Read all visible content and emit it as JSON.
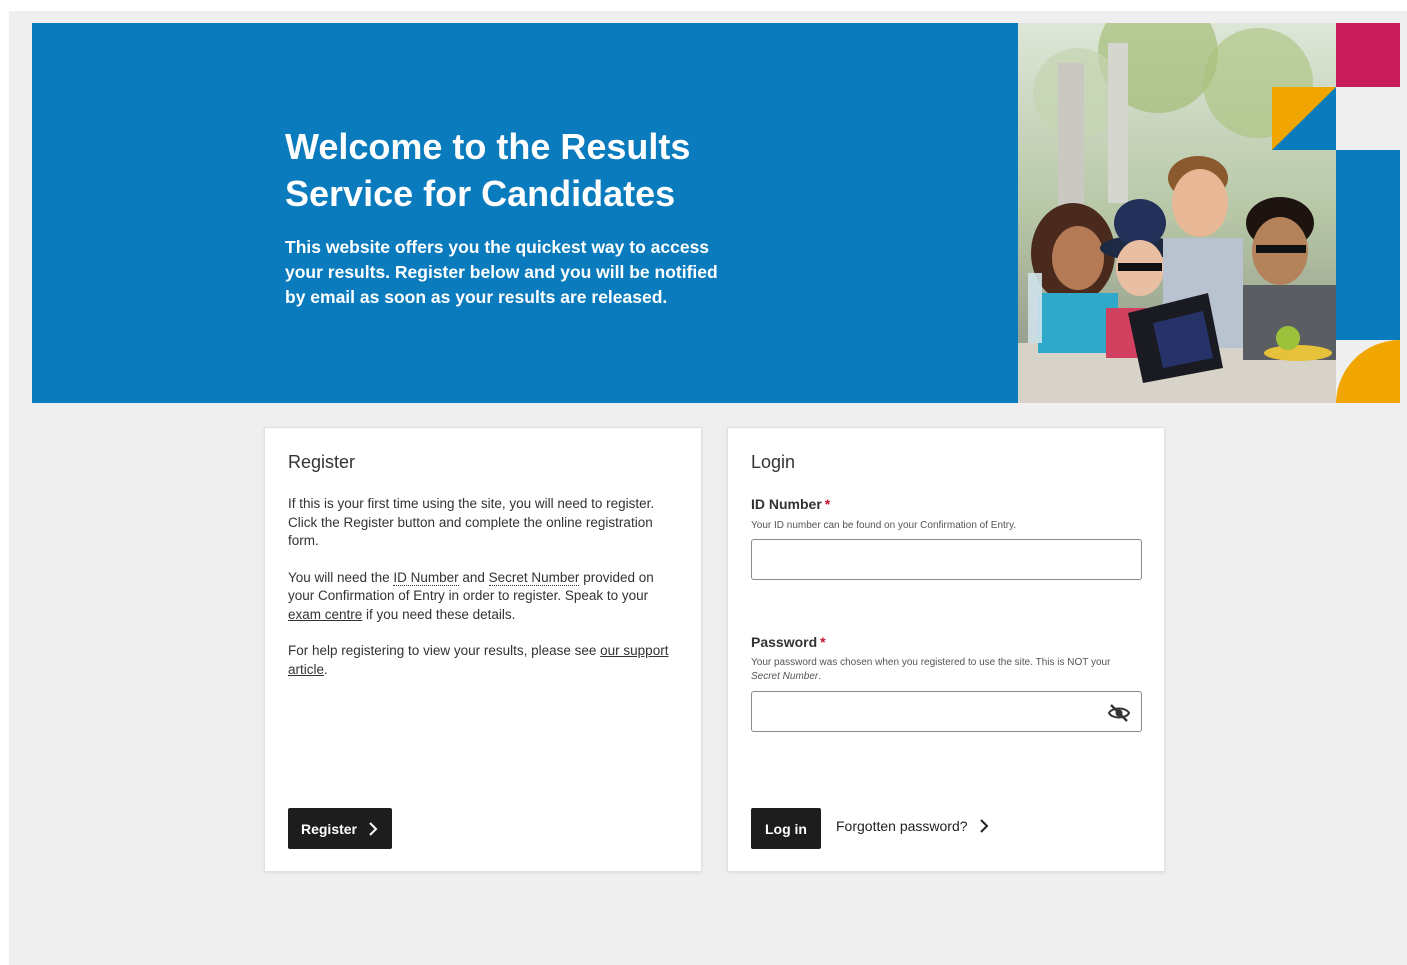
{
  "hero": {
    "title": "Welcome to the Results Service for Candidates",
    "subtitle": "This website offers you the quickest way to access your results. Register below and you will be notified by email as soon as your results are released."
  },
  "register": {
    "heading": "Register",
    "p1": "If this is your first time using the site, you will need to register. Click the Register button and complete the online registration form.",
    "p2_start": "You will need the ",
    "id_number_term": "ID Number",
    "p2_and": " and ",
    "secret_number_term": "Secret Number",
    "p2_mid": " provided on your Confirmation of Entry in order to register. Speak to your ",
    "exam_centre_link": "exam centre",
    "p2_end": " if you need these details.",
    "p3_start": "For help registering to view your results, please see ",
    "support_link": "our support article",
    "p3_end": ".",
    "button_label": "Register"
  },
  "login": {
    "heading": "Login",
    "id_label": "ID Number",
    "id_hint": "Your ID number can be found on your Confirmation of Entry.",
    "id_value": "",
    "password_label": "Password",
    "password_hint_start": "Your password was chosen when you registered to use the site. This is NOT your ",
    "password_hint_term": "Secret Number",
    "password_hint_end": ".",
    "password_value": "",
    "required_mark": "*",
    "login_button": "Log in",
    "forgot_link": "Forgotten password?"
  },
  "colors": {
    "hero_blue": "#0a7bbd",
    "button_dark": "#1d1d1d",
    "required_red": "#c8102e",
    "accent_magenta": "#c81d5a",
    "accent_orange": "#f0a500"
  },
  "icons": {
    "chevron": "chevron-right-icon",
    "eye": "eye-off-icon"
  }
}
